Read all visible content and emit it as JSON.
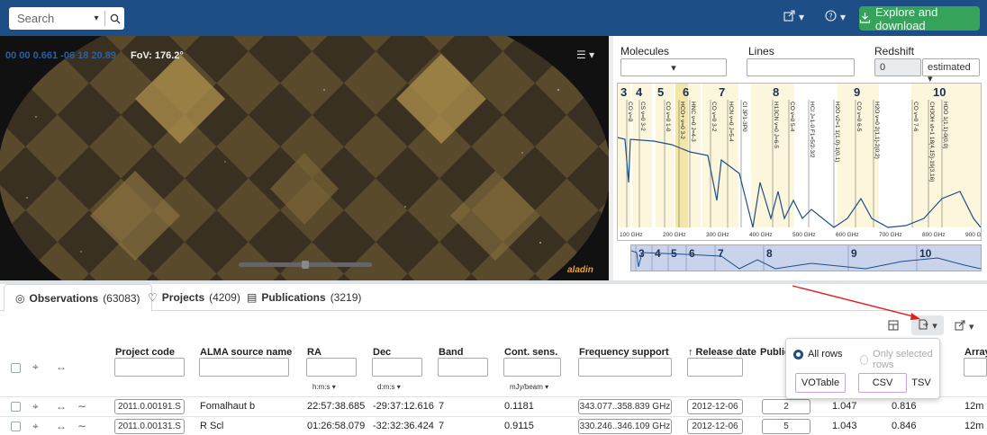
{
  "header": {
    "search_placeholder": "Search",
    "share_icon": "share-icon",
    "help_icon": "help-icon",
    "explore_label": "Explore and download"
  },
  "sky": {
    "coords": "00 00 0.661 -06 18 20.89",
    "fov": "FoV: 176.2°",
    "logo": "aladin"
  },
  "spectrum": {
    "molecules_label": "Molecules",
    "lines_label": "Lines",
    "redshift_label": "Redshift",
    "redshift_value": "0",
    "redshift_mode": "estimated",
    "bands": [
      "3",
      "4",
      "5",
      "6",
      "7",
      "8",
      "9",
      "10"
    ],
    "line_labels": [
      "CO v=0",
      "CS v=0 3-2",
      "CO v=0 1-0",
      "HCO+ v=0 3-2",
      "HNC v=0 J=4-3",
      "CO v=0 3-2",
      "HCN v=0 J=5-4",
      "CI 3P1-3P0",
      "H13CN v=0 J=6-5",
      "CO v=0 5-4",
      "HCl J=1-0 F1=5/2-3/2",
      "H2O v2=1 1(1,0)-1(0,1)",
      "CO v=0 6-5",
      "H2O v=0 2(1,1)-2(0,2)",
      "CO v=0 7-6",
      "CH3OH vt=1 18(4,15)-19(3,16)",
      "HDO 1(1,1)-0(0,0)"
    ],
    "axis_ticks": [
      "100 GHz",
      "200 GHz",
      "300 GHz",
      "400 GHz",
      "500 GHz",
      "600 GHz",
      "700 GHz",
      "800 GHz",
      "900 GHz"
    ]
  },
  "tabs": [
    {
      "label": "Observations",
      "count": "(63083)",
      "icon": "eye-icon"
    },
    {
      "label": "Projects",
      "count": "(4209)",
      "icon": "lightbulb-icon"
    },
    {
      "label": "Publications",
      "count": "(3219)",
      "icon": "book-icon"
    }
  ],
  "table": {
    "columns": [
      "Project code",
      "ALMA source name",
      "RA",
      "Dec",
      "Band",
      "Cont. sens.",
      "Frequency support",
      "↑ Release date",
      "Publications",
      "",
      "",
      "Array"
    ],
    "units": {
      "ra": "h:m:s ▾",
      "dec": "d:m:s ▾",
      "sens": "mJy/beam ▾"
    },
    "rows": [
      {
        "project": "2011.0.00191.S",
        "source": "Fomalhaut b",
        "ra": "22:57:38.685",
        "dec": "-29:37:12.616",
        "band": "7",
        "sens": "0.1181",
        "freq": "343.077..358.839 GHz",
        "release": "2012-12-06",
        "pubs": "2",
        "c1": "1.047",
        "c2": "0.816",
        "array": "12m"
      },
      {
        "project": "2011.0.00131.S",
        "source": "R Scl",
        "ra": "01:26:58.079",
        "dec": "-32:32:36.424",
        "band": "7",
        "sens": "0.9115",
        "freq": "330.246..346.109 GHz",
        "release": "2012-12-06",
        "pubs": "5",
        "c1": "1.043",
        "c2": "0.846",
        "array": "12m"
      }
    ]
  },
  "export_popup": {
    "all_rows": "All rows",
    "selected_rows": "Only selected rows",
    "formats": [
      "VOTable",
      "CSV",
      "TSV"
    ]
  },
  "colors": {
    "brand": "#1d4f86",
    "accent": "#36a35a",
    "arrow": "#e02020"
  }
}
